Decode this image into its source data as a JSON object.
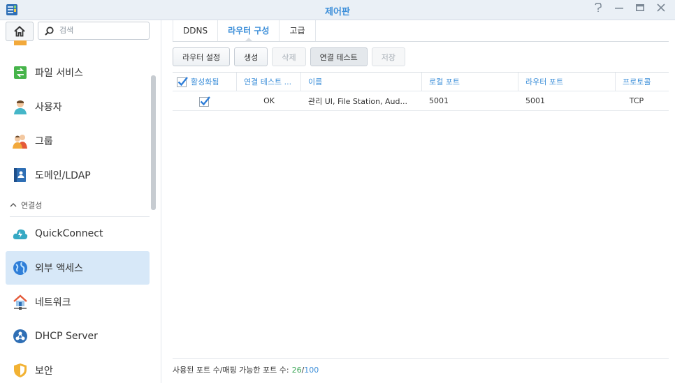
{
  "window": {
    "title": "제어판"
  },
  "sidebar": {
    "search_placeholder": "검색",
    "items": [
      {
        "label": "파일 서비스",
        "icon": "file-services-icon"
      },
      {
        "label": "사용자",
        "icon": "user-icon"
      },
      {
        "label": "그룹",
        "icon": "group-icon"
      },
      {
        "label": "도메인/LDAP",
        "icon": "domain-ldap-icon"
      }
    ],
    "section_label": "연결성",
    "connectivity_items": [
      {
        "label": "QuickConnect",
        "icon": "quickconnect-icon"
      },
      {
        "label": "외부 액세스",
        "icon": "external-access-icon",
        "active": true
      },
      {
        "label": "네트워크",
        "icon": "network-icon"
      },
      {
        "label": "DHCP Server",
        "icon": "dhcp-server-icon"
      },
      {
        "label": "보안",
        "icon": "security-icon"
      }
    ]
  },
  "tabs": [
    {
      "label": "DDNS"
    },
    {
      "label": "라우터 구성",
      "active": true
    },
    {
      "label": "고급"
    }
  ],
  "toolbar": {
    "router_setup": "라우터 설정",
    "create": "생성",
    "delete": "삭제",
    "connection_test": "연결 테스트",
    "save": "저장"
  },
  "table": {
    "columns": [
      "활성화됨",
      "연결 테스트 ...",
      "이름",
      "로컬 포트",
      "라우터 포트",
      "프로토콜"
    ],
    "rows": [
      {
        "enabled": true,
        "test": "OK",
        "name": "관리 UI, File Station, Aud...",
        "local_port": "5001",
        "router_port": "5001",
        "protocol": "TCP"
      }
    ]
  },
  "status": {
    "label": "사용된 포트 수/매핑 가능한 포트 수:",
    "used": "26",
    "separator": "/",
    "total": "100"
  },
  "colors": {
    "accent": "#3d8fd9",
    "used": "#3aa655",
    "active_bg": "#d7e8f8"
  }
}
